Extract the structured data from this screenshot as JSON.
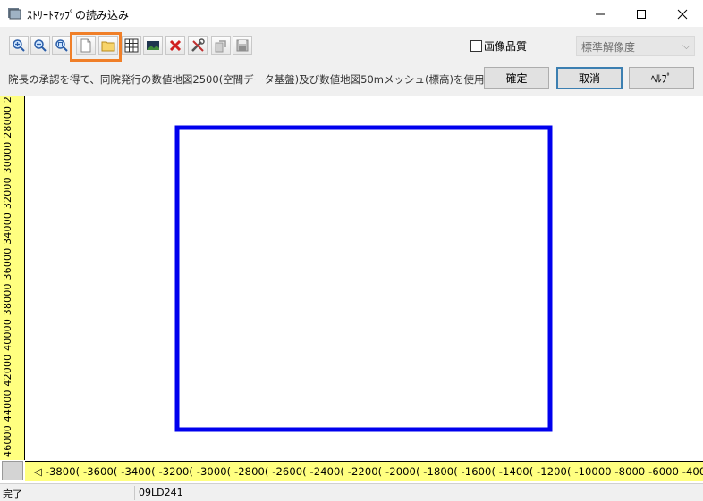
{
  "window": {
    "title": "ｽﾄﾘｰﾄﾏｯﾌﾟの読み込み"
  },
  "toolbar": {
    "buttons": [
      {
        "name": "zoom-in-icon"
      },
      {
        "name": "zoom-out-icon"
      },
      {
        "name": "zoom-fit-icon"
      },
      {
        "name": "new-file-icon"
      },
      {
        "name": "open-folder-icon"
      },
      {
        "name": "grid-icon"
      },
      {
        "name": "landscape-icon"
      },
      {
        "name": "delete-icon"
      },
      {
        "name": "tools-icon"
      },
      {
        "name": "export-icon"
      },
      {
        "name": "save-icon"
      }
    ],
    "image_quality_label": "画像品質",
    "resolution_select": "標準解像度"
  },
  "infobar": {
    "notice": "院長の承認を得て、同院発行の数値地図2500(空間データ基盤)及び数値地図50mメッシュ(標高)を使用した",
    "ok_label": "確定",
    "cancel_label": "取消",
    "help_label": "ﾍﾙﾌﾟ"
  },
  "map": {
    "vertical_ruler": "46000 44000 42000 40000 38000 36000 34000 32000 30000 28000 2",
    "horizontal_ruler": "◁ -3800( -3600( -3400( -3200( -3000( -2800( -2600( -2400( -2200( -2000( -1800( -1600( -1400( -1200( -10000 -8000  -6000  -4000  -2000    0  ▷",
    "rect_color": "#0000ee"
  },
  "status": {
    "state": "完了",
    "code": "09LD241"
  }
}
